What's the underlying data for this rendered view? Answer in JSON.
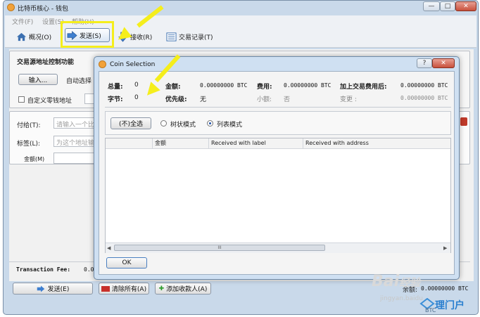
{
  "window": {
    "title": "比特币核心 - 钱包",
    "min": "—",
    "max": "□",
    "close": "✕"
  },
  "menu": [
    "文件(F)",
    "设置(S)",
    "帮助(H)"
  ],
  "toolbar": {
    "overview": "概况(O)",
    "send": "发送(S)",
    "receive": "接收(R)",
    "transactions": "交易记录(T)"
  },
  "coin_control": {
    "title": "交易源地址控制功能",
    "inputs_button": "输入...",
    "auto_select": "自动选择",
    "custom_change": "自定义零钱地址"
  },
  "recipient": {
    "pay_to_label": "付给(T):",
    "pay_to_placeholder": "请输入一个比",
    "label_label": "标签(L):",
    "label_placeholder": "为这个地址输",
    "amount_label": "金额(M)"
  },
  "footer": {
    "tx_fee_label": "Transaction Fee:",
    "tx_fee_value": "0.0",
    "send_button": "发送(E)",
    "clear_button": "清除所有(A)",
    "add_recipient_button": "添加收款人(A)",
    "balance_label": "余额:",
    "balance_value": "0.00000000 BTC"
  },
  "dialog": {
    "title": "Coin Selection",
    "help": "?",
    "close": "✕",
    "summary": {
      "quantity_label": "总量:",
      "quantity_value": "0",
      "amount_label": "金额:",
      "amount_value": "0.00000000 BTC",
      "fee_label": "费用:",
      "fee_value": "0.00000000 BTC",
      "after_fee_label": "加上交易费用后:",
      "after_fee_value": "0.00000000 BTC",
      "bytes_label": "字节:",
      "bytes_value": "0",
      "priority_label": "优先级:",
      "priority_value": "无",
      "low_output_label": "小额:",
      "low_output_value": "否",
      "change_label": "变更 :",
      "change_value": "0.00000000 BTC"
    },
    "select_all_button": "(不)全选",
    "tree_mode": "树状模式",
    "list_mode": "列表模式",
    "columns": [
      "",
      "金额",
      "Received with label",
      "Received with address"
    ],
    "scroll_grip": "III",
    "ok_button": "OK"
  },
  "watermark": {
    "brand": "Bai",
    "brand_tail": "经验",
    "site": "jingyan.baidu",
    "corner": "理门户",
    "corner_sub": "BTC"
  },
  "colors": {
    "highlight": "#f5ee1c",
    "window_frame": "#c9d9ea",
    "dialog_frame": "#cfe0f2"
  },
  "icons": [
    "bitcoin-app-icon",
    "home-icon",
    "send-arrow-icon",
    "receive-arrow-icon",
    "list-icon"
  ]
}
